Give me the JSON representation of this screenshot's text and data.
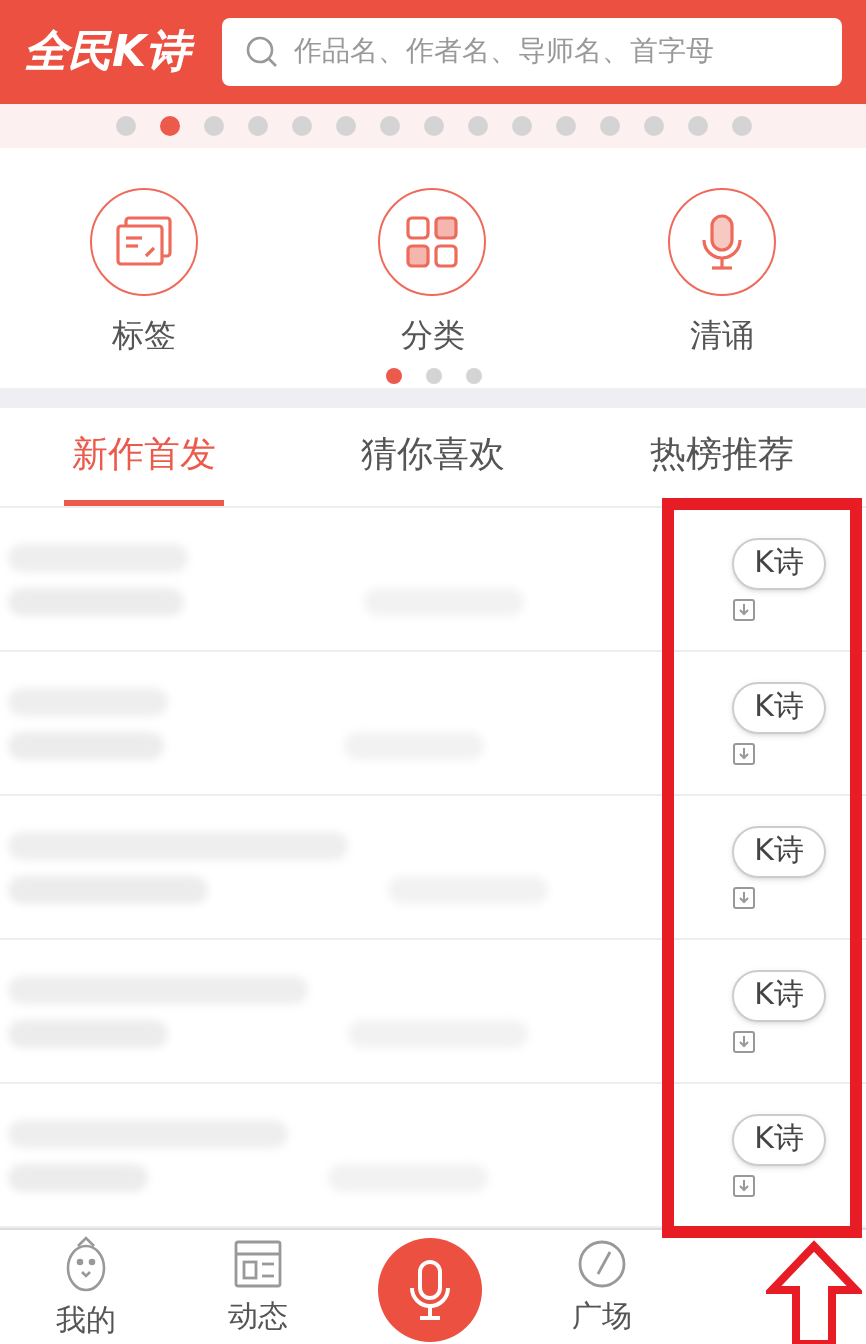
{
  "header": {
    "logo": "全民K诗",
    "search": {
      "placeholder": "作品名、作者名、导师名、首字母"
    }
  },
  "banner_dots": [
    {
      "selected": false
    },
    {
      "selected": true
    },
    {
      "selected": false
    },
    {
      "selected": false
    },
    {
      "selected": false
    },
    {
      "selected": false
    },
    {
      "selected": false
    },
    {
      "selected": false
    },
    {
      "selected": false
    },
    {
      "selected": false
    },
    {
      "selected": false
    },
    {
      "selected": false
    },
    {
      "selected": false
    },
    {
      "selected": false
    },
    {
      "selected": false
    }
  ],
  "shortcuts": [
    {
      "kind": "tag",
      "label": "标签"
    },
    {
      "kind": "category",
      "label": "分类"
    },
    {
      "kind": "recite",
      "label": "清诵"
    }
  ],
  "shortcut_pages": [
    {
      "selected": true
    },
    {
      "selected": false
    },
    {
      "selected": false
    }
  ],
  "tabs": [
    {
      "label": "新作首发",
      "selected": true
    },
    {
      "label": "猜你喜欢",
      "selected": false
    },
    {
      "label": "热榜推荐",
      "selected": false
    }
  ],
  "rows": [
    {
      "button": "K诗"
    },
    {
      "button": "K诗"
    },
    {
      "button": "K诗"
    },
    {
      "button": "K诗"
    },
    {
      "button": "K诗"
    }
  ],
  "nav": [
    {
      "kind": "me",
      "label": "我的"
    },
    {
      "kind": "feed",
      "label": "动态"
    },
    {
      "kind": "record"
    },
    {
      "kind": "square",
      "label": "广场"
    }
  ],
  "highlight": {
    "shown": true
  }
}
